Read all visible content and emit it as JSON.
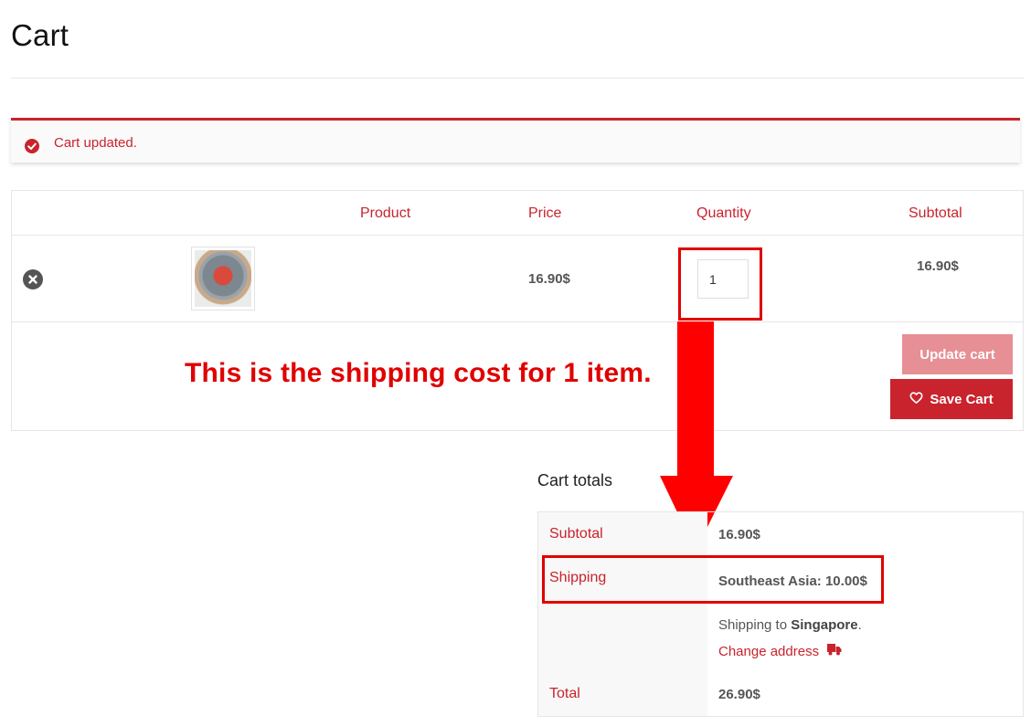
{
  "page": {
    "title": "Cart"
  },
  "notice": {
    "message": "Cart updated."
  },
  "table": {
    "headers": {
      "product": "Product",
      "price": "Price",
      "quantity": "Quantity",
      "subtotal": "Subtotal"
    },
    "row": {
      "price": "16.90$",
      "quantity": "1",
      "subtotal": "16.90$"
    }
  },
  "actions": {
    "update_cart": "Update cart",
    "save_cart": "Save Cart"
  },
  "annotation": {
    "text": "This is the shipping cost for 1 item."
  },
  "totals": {
    "heading": "Cart totals",
    "subtotal_label": "Subtotal",
    "subtotal_value": "16.90$",
    "shipping_label": "Shipping",
    "shipping_value": "Southeast Asia: 10.00$",
    "shipping_to_prefix": "Shipping to ",
    "shipping_to_country": "Singapore",
    "shipping_to_suffix": ".",
    "change_address": "Change address",
    "total_label": "Total",
    "total_value": "26.90$"
  },
  "colors": {
    "accent": "#c9232d",
    "annotation": "#e00000",
    "update_button": "#e68f94"
  },
  "icons": [
    "check-circle-icon",
    "remove-icon",
    "heart-icon",
    "truck-icon",
    "down-arrow-icon"
  ]
}
